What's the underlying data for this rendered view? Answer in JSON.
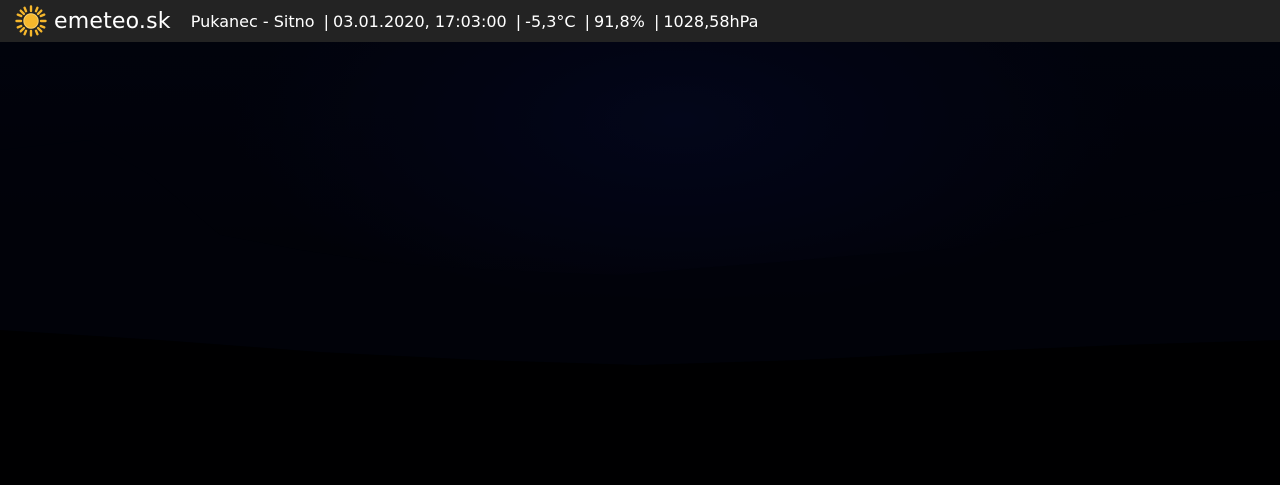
{
  "header": {
    "brand": "emeteo.sk",
    "logo_icon": "sun-icon",
    "station": "Pukanec - Sitno",
    "datetime": "03.01.2020, 17:03:00",
    "temperature": "-5,3°C",
    "humidity": "91,8%",
    "pressure": "1028,58hPa",
    "separator": "|"
  },
  "colors": {
    "header_bg": "#232323",
    "sun": "#f6b72c"
  }
}
